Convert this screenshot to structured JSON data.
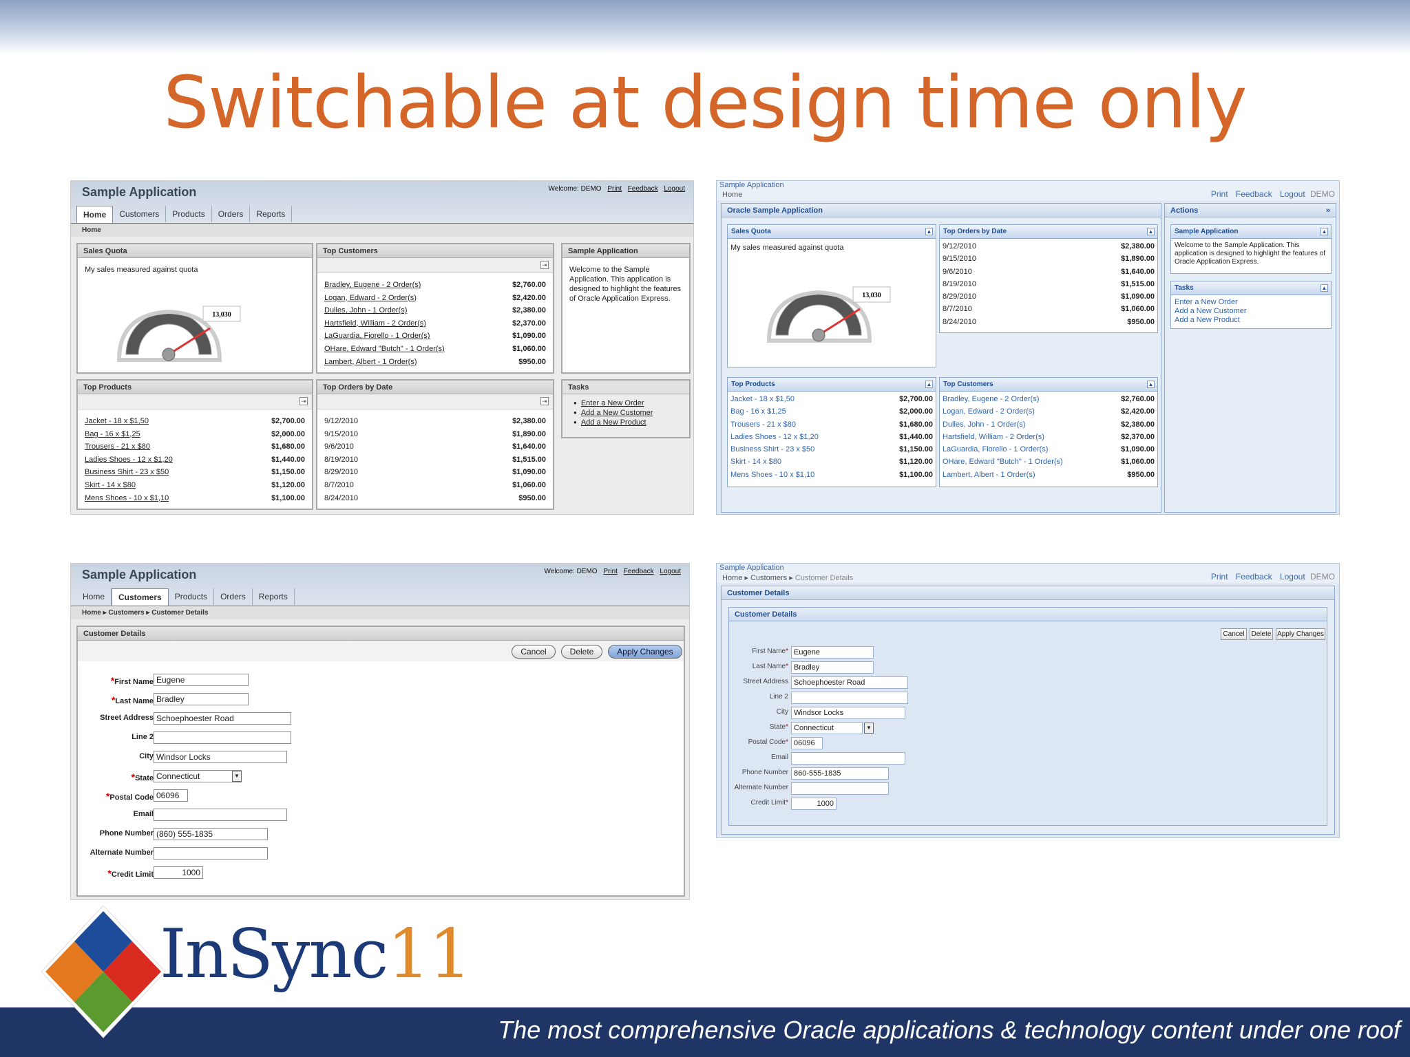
{
  "slide": {
    "title": "Switchable at design time only",
    "tagline": "The most comprehensive Oracle applications & technology content under one roof",
    "logo": {
      "name": "InSync",
      "number": "11"
    }
  },
  "themeA_home": {
    "app_title": "Sample Application",
    "welcome": "Welcome: DEMO",
    "links": [
      "Print",
      "Feedback",
      "Logout"
    ],
    "tabs": [
      "Home",
      "Customers",
      "Products",
      "Orders",
      "Reports"
    ],
    "active_tab": "Home",
    "breadcrumb": "Home",
    "sales_quota": {
      "title": "Sales Quota",
      "text": "My sales measured against quota",
      "gauge_value": "13,030"
    },
    "top_customers": {
      "title": "Top Customers",
      "rows": [
        {
          "label": "Bradley, Eugene - 2 Order(s)",
          "value": "$2,760.00"
        },
        {
          "label": "Logan, Edward - 2 Order(s)",
          "value": "$2,420.00"
        },
        {
          "label": "Dulles, John - 1 Order(s)",
          "value": "$2,380.00"
        },
        {
          "label": "Hartsfield, William - 2 Order(s)",
          "value": "$2,370.00"
        },
        {
          "label": "LaGuardia, Fiorello - 1 Order(s)",
          "value": "$1,090.00"
        },
        {
          "label": "OHare, Edward \"Butch\" - 1 Order(s)",
          "value": "$1,060.00"
        },
        {
          "label": "Lambert, Albert - 1 Order(s)",
          "value": "$950.00"
        }
      ]
    },
    "sample_app": {
      "title": "Sample Application",
      "text": "Welcome to the Sample Application. This application is designed to highlight the features of Oracle Application Express."
    },
    "top_products": {
      "title": "Top Products",
      "rows": [
        {
          "label": "Jacket - 18 x $1,50",
          "value": "$2,700.00"
        },
        {
          "label": "Bag - 16 x $1,25",
          "value": "$2,000.00"
        },
        {
          "label": "Trousers - 21 x $80",
          "value": "$1,680.00"
        },
        {
          "label": "Ladies Shoes - 12 x $1,20",
          "value": "$1,440.00"
        },
        {
          "label": "Business Shirt - 23 x $50",
          "value": "$1,150.00"
        },
        {
          "label": "Skirt - 14 x $80",
          "value": "$1,120.00"
        },
        {
          "label": "Mens Shoes - 10 x $1,10",
          "value": "$1,100.00"
        }
      ]
    },
    "top_orders": {
      "title": "Top Orders by Date",
      "rows": [
        {
          "label": "9/12/2010",
          "value": "$2,380.00"
        },
        {
          "label": "9/15/2010",
          "value": "$1,890.00"
        },
        {
          "label": "9/6/2010",
          "value": "$1,640.00"
        },
        {
          "label": "8/19/2010",
          "value": "$1,515.00"
        },
        {
          "label": "8/29/2010",
          "value": "$1,090.00"
        },
        {
          "label": "8/7/2010",
          "value": "$1,060.00"
        },
        {
          "label": "8/24/2010",
          "value": "$950.00"
        }
      ]
    },
    "tasks": {
      "title": "Tasks",
      "items": [
        "Enter a New Order",
        "Add a New Customer",
        "Add a New Product"
      ]
    }
  },
  "themeB_home": {
    "app_title": "Sample Application",
    "breadcrumb": "Home",
    "links": [
      "Print",
      "Feedback",
      "Logout"
    ],
    "user": "DEMO",
    "region_title": "Oracle Sample Application",
    "actions_title": "Actions",
    "sales_quota": {
      "title": "Sales Quota",
      "text": "My sales measured against quota",
      "gauge_value": "13,030"
    },
    "top_orders": {
      "title": "Top Orders by Date",
      "rows": [
        {
          "label": "9/12/2010",
          "value": "$2,380.00"
        },
        {
          "label": "9/15/2010",
          "value": "$1,890.00"
        },
        {
          "label": "9/6/2010",
          "value": "$1,640.00"
        },
        {
          "label": "8/19/2010",
          "value": "$1,515.00"
        },
        {
          "label": "8/29/2010",
          "value": "$1,090.00"
        },
        {
          "label": "8/7/2010",
          "value": "$1,060.00"
        },
        {
          "label": "8/24/2010",
          "value": "$950.00"
        }
      ]
    },
    "sample_app": {
      "title": "Sample Application",
      "text": "Welcome to the Sample Application. This application is designed to highlight the features of Oracle Application Express."
    },
    "tasks": {
      "title": "Tasks",
      "items": [
        "Enter a New Order",
        "Add a New Customer",
        "Add a New Product"
      ]
    },
    "top_products": {
      "title": "Top Products",
      "rows": [
        {
          "label": "Jacket - 18 x $1,50",
          "value": "$2,700.00"
        },
        {
          "label": "Bag - 16 x $1,25",
          "value": "$2,000.00"
        },
        {
          "label": "Trousers - 21 x $80",
          "value": "$1,680.00"
        },
        {
          "label": "Ladies Shoes - 12 x $1,20",
          "value": "$1,440.00"
        },
        {
          "label": "Business Shirt - 23 x $50",
          "value": "$1,150.00"
        },
        {
          "label": "Skirt - 14 x $80",
          "value": "$1,120.00"
        },
        {
          "label": "Mens Shoes - 10 x $1,10",
          "value": "$1,100.00"
        }
      ]
    },
    "top_customers": {
      "title": "Top Customers",
      "rows": [
        {
          "label": "Bradley, Eugene - 2 Order(s)",
          "value": "$2,760.00"
        },
        {
          "label": "Logan, Edward - 2 Order(s)",
          "value": "$2,420.00"
        },
        {
          "label": "Dulles, John - 1 Order(s)",
          "value": "$2,380.00"
        },
        {
          "label": "Hartsfield, William - 2 Order(s)",
          "value": "$2,370.00"
        },
        {
          "label": "LaGuardia, Fiorello - 1 Order(s)",
          "value": "$1,090.00"
        },
        {
          "label": "OHare, Edward \"Butch\" - 1 Order(s)",
          "value": "$1,060.00"
        },
        {
          "label": "Lambert, Albert - 1 Order(s)",
          "value": "$950.00"
        }
      ]
    }
  },
  "themeA_form": {
    "app_title": "Sample Application",
    "welcome": "Welcome: DEMO",
    "links": [
      "Print",
      "Feedback",
      "Logout"
    ],
    "tabs": [
      "Home",
      "Customers",
      "Products",
      "Orders",
      "Reports"
    ],
    "active_tab": "Customers",
    "breadcrumb": [
      "Home",
      "Customers",
      "Customer Details"
    ],
    "region_title": "Customer Details",
    "buttons": {
      "cancel": "Cancel",
      "delete": "Delete",
      "apply": "Apply Changes"
    },
    "fields": [
      {
        "label": "First Name",
        "value": "Eugene",
        "required": true
      },
      {
        "label": "Last Name",
        "value": "Bradley",
        "required": true
      },
      {
        "label": "Street Address",
        "value": "Schoephoester Road",
        "required": false
      },
      {
        "label": "Line 2",
        "value": "",
        "required": false
      },
      {
        "label": "City",
        "value": "Windsor Locks",
        "required": false
      },
      {
        "label": "State",
        "value": "Connecticut",
        "required": true
      },
      {
        "label": "Postal Code",
        "value": "06096",
        "required": true
      },
      {
        "label": "Email",
        "value": "",
        "required": false
      },
      {
        "label": "Phone Number",
        "value": "(860) 555-1835",
        "required": false
      },
      {
        "label": "Alternate Number",
        "value": "",
        "required": false
      },
      {
        "label": "Credit Limit",
        "value": "1000",
        "required": true
      }
    ]
  },
  "themeB_form": {
    "app_title": "Sample Application",
    "breadcrumb": [
      "Home",
      "Customers",
      "Customer Details"
    ],
    "links": [
      "Print",
      "Feedback",
      "Logout"
    ],
    "user": "DEMO",
    "region_title": "Customer Details",
    "inner_title": "Customer Details",
    "buttons": {
      "cancel": "Cancel",
      "delete": "Delete",
      "apply": "Apply Changes"
    },
    "fields": [
      {
        "label": "First Name",
        "value": "Eugene",
        "required": true
      },
      {
        "label": "Last Name",
        "value": "Bradley",
        "required": true
      },
      {
        "label": "Street Address",
        "value": "Schoephoester Road",
        "required": false
      },
      {
        "label": "Line 2",
        "value": "",
        "required": false
      },
      {
        "label": "City",
        "value": "Windsor Locks",
        "required": false
      },
      {
        "label": "State",
        "value": "Connecticut",
        "required": true
      },
      {
        "label": "Postal Code",
        "value": "06096",
        "required": true
      },
      {
        "label": "Email",
        "value": "",
        "required": false
      },
      {
        "label": "Phone Number",
        "value": "860-555-1835",
        "required": false
      },
      {
        "label": "Alternate Number",
        "value": "",
        "required": false
      },
      {
        "label": "Credit Limit",
        "value": "1000",
        "required": true
      }
    ]
  },
  "colors": {
    "title": "#d4662a",
    "footer": "#1e3566",
    "themeB_link": "#2e64b0"
  }
}
